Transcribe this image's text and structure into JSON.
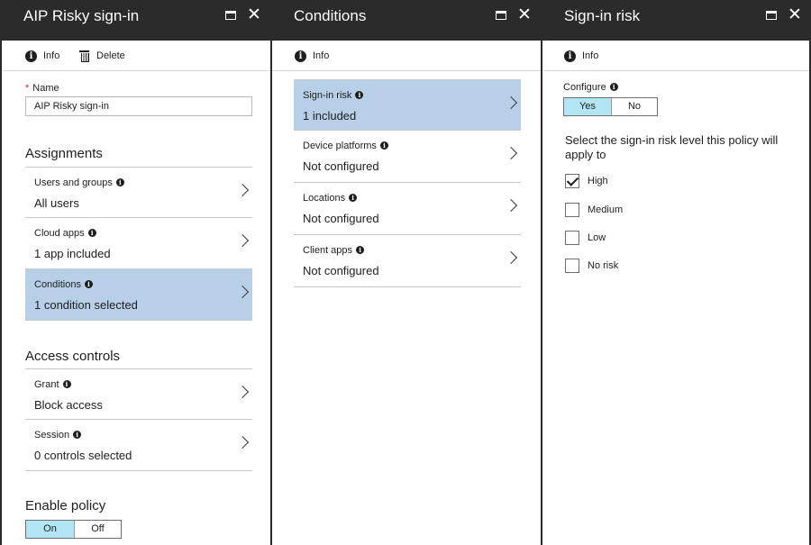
{
  "blade1": {
    "title": "AIP Risky sign-in",
    "cmd_info": "Info",
    "cmd_delete": "Delete",
    "name_label": "Name",
    "name_required_marker": "*",
    "name_value": "AIP Risky sign-in",
    "assignments_title": "Assignments",
    "assignments": [
      {
        "label": "Users and groups",
        "value": "All users"
      },
      {
        "label": "Cloud apps",
        "value": "1 app included"
      },
      {
        "label": "Conditions",
        "value": "1 condition selected"
      }
    ],
    "access_title": "Access controls",
    "access": [
      {
        "label": "Grant",
        "value": "Block access"
      },
      {
        "label": "Session",
        "value": "0 controls selected"
      }
    ],
    "enable_title": "Enable policy",
    "enable_on": "On",
    "enable_off": "Off",
    "enable_selected": "On"
  },
  "blade2": {
    "title": "Conditions",
    "cmd_info": "Info",
    "conditions": [
      {
        "label": "Sign-in risk",
        "value": "1 included"
      },
      {
        "label": "Device platforms",
        "value": "Not configured"
      },
      {
        "label": "Locations",
        "value": "Not configured"
      },
      {
        "label": "Client apps",
        "value": "Not configured"
      }
    ]
  },
  "blade3": {
    "title": "Sign-in risk",
    "cmd_info": "Info",
    "configure_label": "Configure",
    "configure_yes": "Yes",
    "configure_no": "No",
    "configure_selected": "Yes",
    "description": "Select the sign-in risk level this policy will apply to",
    "levels": [
      {
        "label": "High",
        "checked": true
      },
      {
        "label": "Medium",
        "checked": false
      },
      {
        "label": "Low",
        "checked": false
      },
      {
        "label": "No risk",
        "checked": false
      }
    ]
  },
  "icons": {
    "info": "i",
    "close": "✕"
  },
  "colors": {
    "header_bg": "#2b2b2b",
    "selected_row": "#b8d0e7",
    "toggle_on": "#b3e6f5",
    "required": "#c4262e"
  }
}
